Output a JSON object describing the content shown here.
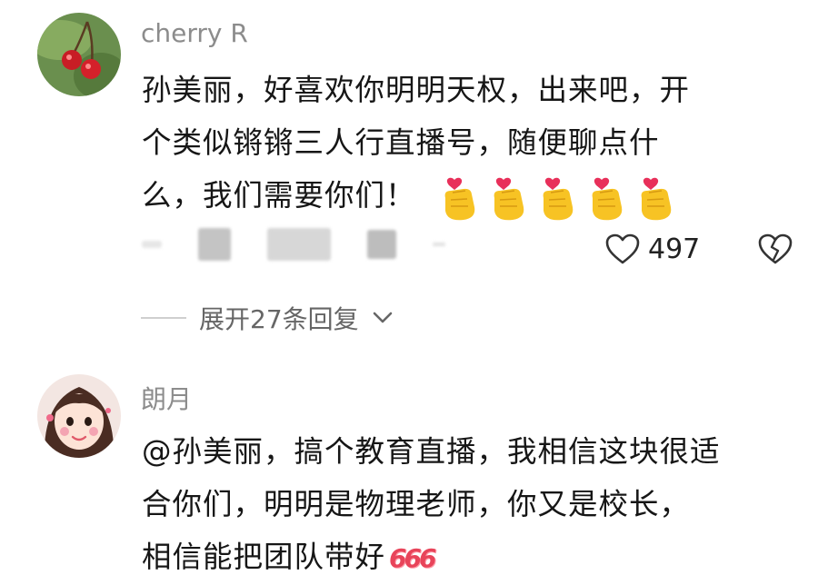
{
  "comments": [
    {
      "username": "cherry R",
      "lines": [
        "孙美丽，好喜欢你明明天权，出来吧，开",
        "个类似锵锵三人行直播号，随便聊点什",
        "么，我们需要你们！"
      ],
      "emoji_icons": [
        "finger-heart-icon",
        "finger-heart-icon",
        "finger-heart-icon",
        "finger-heart-icon",
        "finger-heart-icon"
      ],
      "likes": "497",
      "replies_label": "展开27条回复"
    },
    {
      "username": "朗月",
      "lines": [
        "@孙美丽，搞个教育直播，我相信这块很适",
        "合你们，明明是物理老师，你又是校长，",
        "相信能把团队带好"
      ],
      "suffix": "666"
    }
  ],
  "colors": {
    "username": "#8c8c8c",
    "text": "#161616",
    "accent": "#e8445a"
  }
}
